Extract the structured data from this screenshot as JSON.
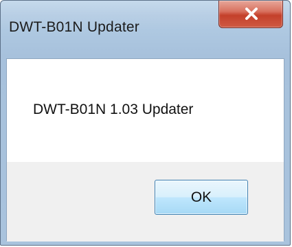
{
  "window": {
    "title": "DWT-B01N Updater",
    "close_icon": "close-icon"
  },
  "dialog": {
    "message": "DWT-B01N 1.03 Updater",
    "ok_label": "OK"
  },
  "colors": {
    "close_button": "#c4402b",
    "titlebar": "#b9cfe5",
    "footer": "#f0f0f0",
    "ok_border": "#3c7fb1"
  }
}
